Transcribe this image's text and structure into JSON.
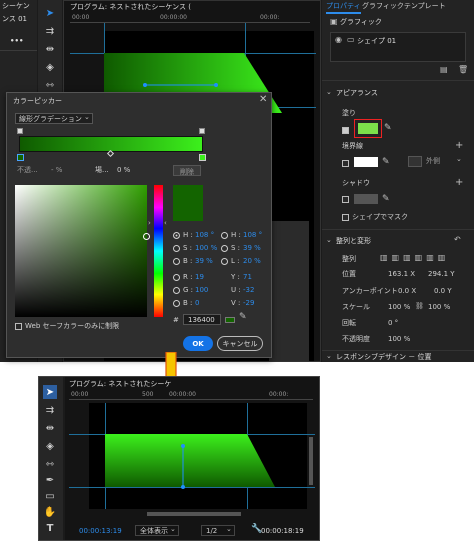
{
  "top": {
    "left_panel": {
      "tab_label": "シーケン",
      "sequence_label": "ンス 01",
      "menu_dots": "•••"
    },
    "program_header": {
      "title": "プログラム: ネストされたシーケンス (",
      "ruler": [
        "00:00",
        "00:00:00",
        "00:00:"
      ]
    },
    "properties": {
      "tab_properties": "プロパティ",
      "tab_graphic_template": "グラフィックテンプレート",
      "section_graphic": "グラフィック",
      "layer_name": "シェイプ 01",
      "appearance_title": "アピアランス",
      "fill_label": "塗り",
      "stroke_label": "境界線",
      "outer_dropdown": "外側",
      "shadow_label": "シャドウ",
      "mask_label": "シェイプでマスク",
      "align_title": "整列と変形",
      "align_label": "整列",
      "position_label": "位置",
      "position_x": "163.1 X",
      "position_y": "294.1 Y",
      "anchor_label": "アンカーポイント",
      "anchor_x": "0.0 X",
      "anchor_y": "0.0 Y",
      "scale_label": "スケール",
      "scale_w": "100 %",
      "scale_h": "100 %",
      "rotation_label": "回転",
      "rotation_value": "0 °",
      "opacity_label": "不透明度",
      "opacity_value": "100 %",
      "responsive_title": "レスポンシブデザイン － 位置",
      "fill_color": "#7ce04a"
    },
    "color_picker": {
      "title": "カラーピッカー",
      "gradient_type": "線形グラデーション",
      "opacity_label": "不透...",
      "opacity_value": "- %",
      "position_label": "場...",
      "position_value": "0 %",
      "delete_button": "削除",
      "hsb": {
        "h_label": "H :",
        "h_value": "108 °",
        "s_label": "S :",
        "s_value": "100 %",
        "b_label": "B :",
        "b_value": "39 %"
      },
      "hsl": {
        "h_label": "H :",
        "h_value": "108 °",
        "s_label": "S :",
        "s_value": "39 %",
        "l_label": "L :",
        "l_value": "20 %"
      },
      "rgb": {
        "r_label": "R :",
        "r_value": "19",
        "g_label": "G :",
        "g_value": "100",
        "b_label": "B :",
        "b_value": "0"
      },
      "yuv": {
        "y_label": "Y :",
        "y_value": "71",
        "u_label": "U :",
        "u_value": "-32",
        "v_label": "V :",
        "v_value": "-29"
      },
      "hex_label": "#",
      "hex_value": "136400",
      "web_safe_label": "Web セーフカラーのみに制限",
      "ok_button": "OK",
      "cancel_button": "キャンセル",
      "preview_color": "#136400"
    }
  },
  "bottom": {
    "program_title": "プログラム: ネストされたシーケ",
    "ruler": [
      "00:00",
      "00:00:00",
      "00:00:"
    ],
    "ruler_mark": "500",
    "current_time": "00:00:13:19",
    "zoom_select": "全体表示",
    "resolution_select": "1/2",
    "duration": "00:00:18:19",
    "tools": [
      "selection-tool",
      "track-select-tool",
      "ripple-edit-tool",
      "razor-tool",
      "slip-tool",
      "pen-tool",
      "rectangle-tool",
      "hand-tool",
      "type-tool"
    ]
  },
  "arrow_color": "#f5c400"
}
